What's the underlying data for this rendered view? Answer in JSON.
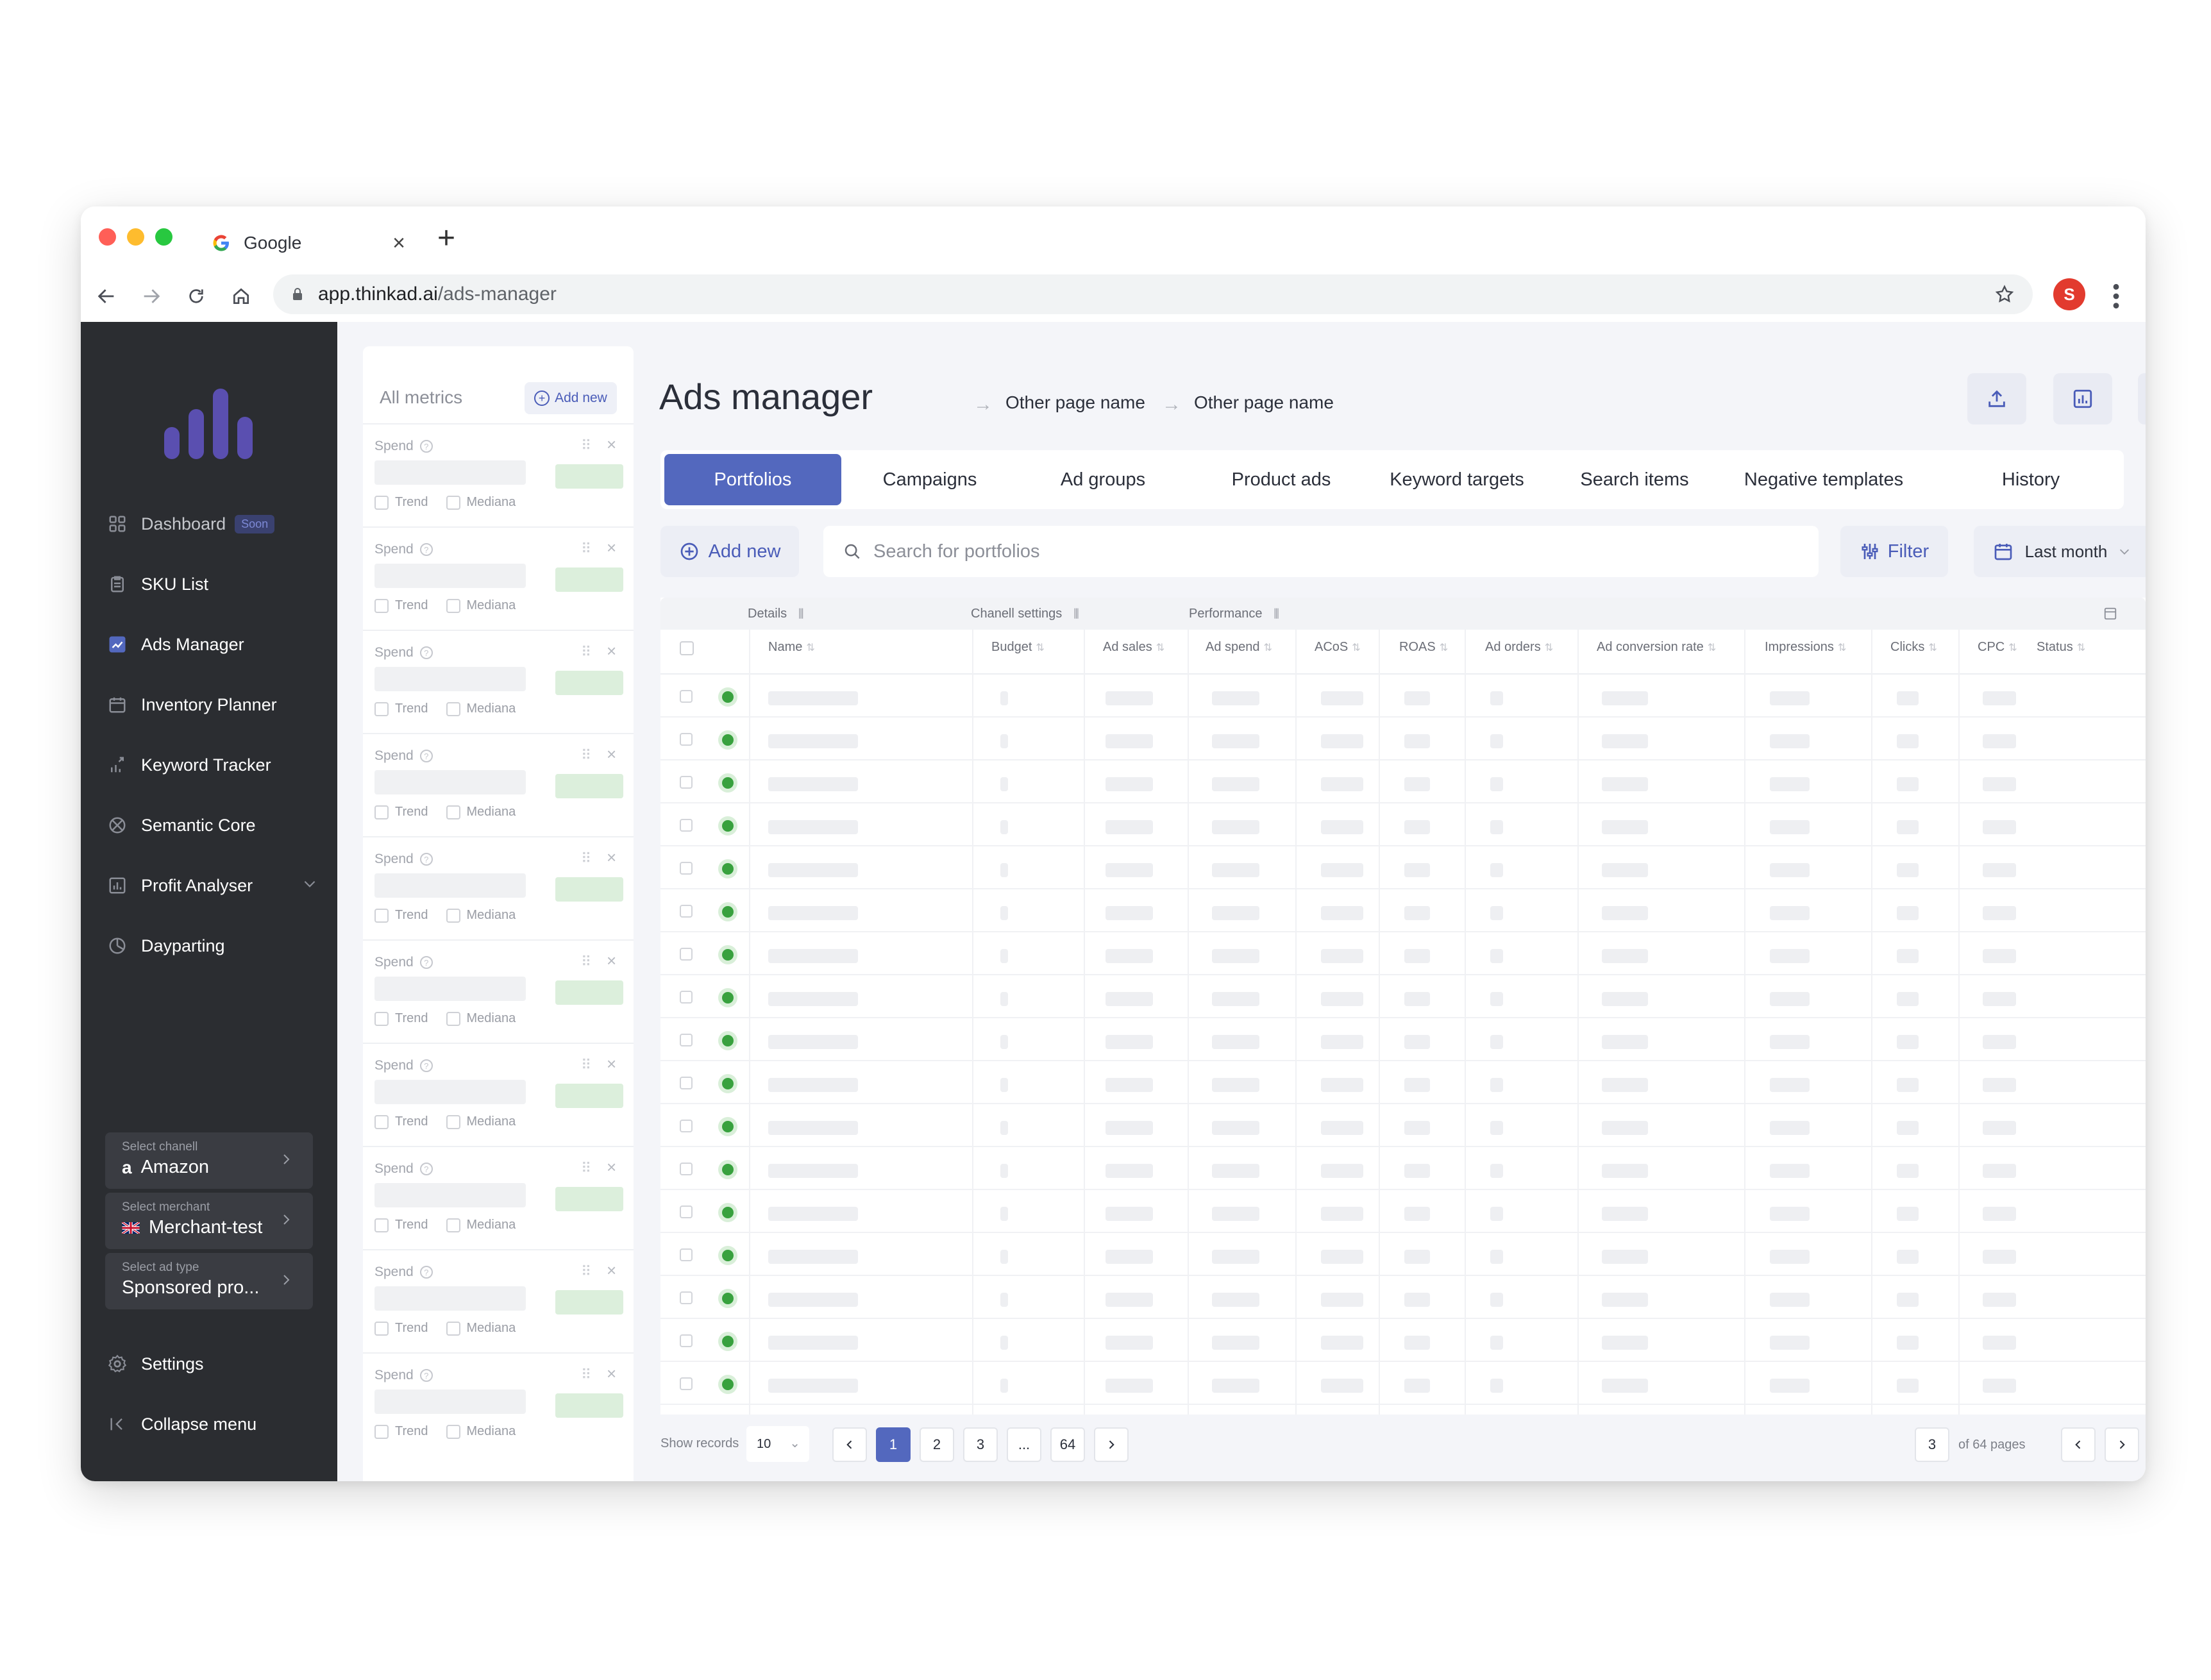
{
  "browser": {
    "tab_title": "Google",
    "tab_close": "×",
    "new_tab": "+",
    "url_host": "app.thinkad.ai",
    "url_path": "/ads-manager",
    "profile_initial": "S"
  },
  "sidebar": {
    "items": [
      {
        "label": "Dashboard",
        "icon": "dashboard-icon",
        "badge": "Soon"
      },
      {
        "label": "SKU List",
        "icon": "clipboard-icon"
      },
      {
        "label": "Ads Manager",
        "icon": "ads-manager-icon"
      },
      {
        "label": "Inventory Planner",
        "icon": "calendar-icon"
      },
      {
        "label": "Keyword Tracker",
        "icon": "keyword-tracker-icon"
      },
      {
        "label": "Semantic Core",
        "icon": "semantic-core-icon"
      },
      {
        "label": "Profit Analyser",
        "icon": "chart-icon"
      },
      {
        "label": "Dayparting",
        "icon": "clock-icon"
      }
    ],
    "channel": {
      "label": "Select chanell",
      "value": "Amazon",
      "logo": "a"
    },
    "merchant": {
      "label": "Select merchant",
      "value": "Merchant-test"
    },
    "ad_type": {
      "label": "Select ad type",
      "value": "Sponsored pro..."
    },
    "settings": "Settings",
    "collapse": "Collapse menu"
  },
  "metrics_panel": {
    "title": "All metrics",
    "add_new": "Add new",
    "card": {
      "label": "Spend",
      "trend": "Trend",
      "mediana": "Mediana"
    },
    "card_count": 10
  },
  "header": {
    "title": "Ads manager",
    "crumbs": [
      "Other page name",
      "Other page name"
    ]
  },
  "tabs": [
    "Portfolios",
    "Campaigns",
    "Ad groups",
    "Product ads",
    "Keyword targets",
    "Search items",
    "Negative templates",
    "History"
  ],
  "toolbar": {
    "add_new": "Add new",
    "search_placeholder": "Search for portfolios",
    "filter": "Filter",
    "date_range": "Last month"
  },
  "table": {
    "groups": [
      "Details",
      "Chanell settings",
      "Performance"
    ],
    "columns": [
      "Name",
      "Budget",
      "Ad sales",
      "Ad spend",
      "ACoS",
      "ROAS",
      "Ad orders",
      "Ad conversion rate",
      "Impressions",
      "Clicks",
      "CPC",
      "Status"
    ],
    "row_count": 17,
    "row_status_color": "#38a13e"
  },
  "footer": {
    "show_records_label": "Show records",
    "show_records_value": "10",
    "pages": [
      "1",
      "2",
      "3",
      "...",
      "64"
    ],
    "current_page": "1",
    "page_input": "3",
    "of_pages": "of 64 pages"
  },
  "colors": {
    "accent": "#5368be",
    "sidebar_bg": "#2b2d31",
    "logo": "#5a4fb0"
  }
}
